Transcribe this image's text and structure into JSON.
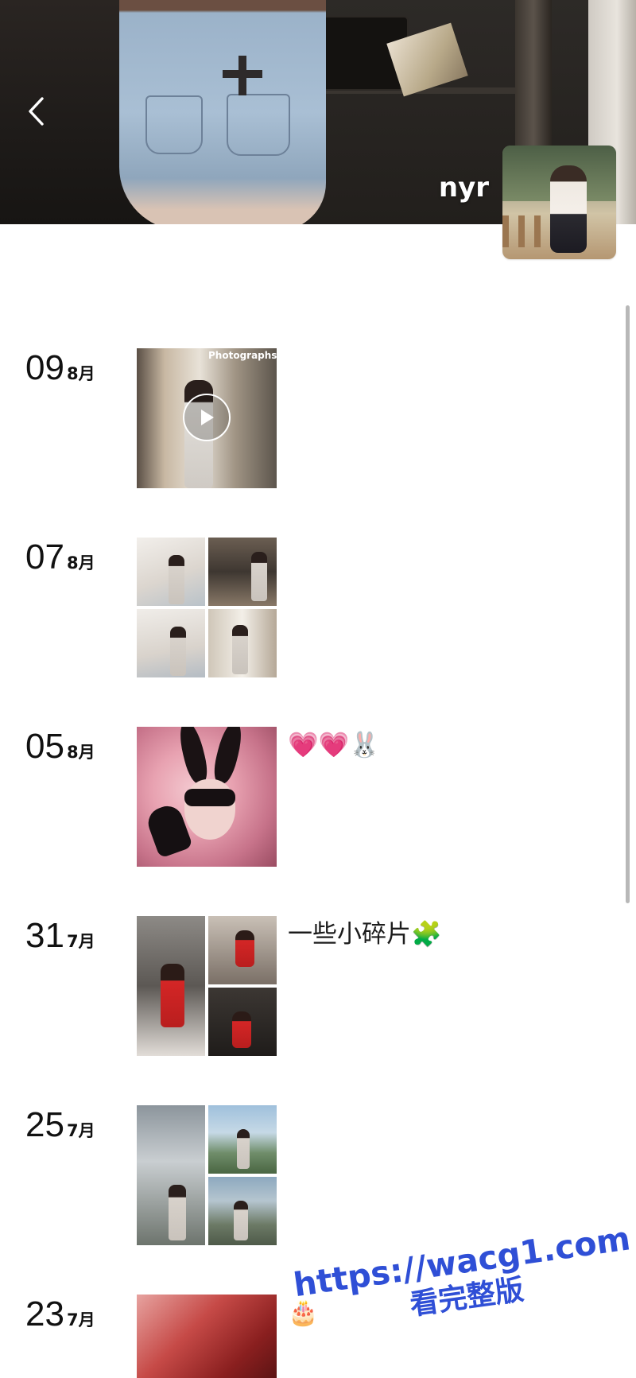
{
  "header": {
    "profile_name": "nyr"
  },
  "posts": [
    {
      "day": "09",
      "month": "8月",
      "caption": "",
      "media_type": "video"
    },
    {
      "day": "07",
      "month": "8月",
      "caption": "",
      "media_type": "grid-4"
    },
    {
      "day": "05",
      "month": "8月",
      "caption": "💗💗🐰",
      "media_type": "single"
    },
    {
      "day": "31",
      "month": "7月",
      "caption": "一些小碎片🧩",
      "media_type": "grid-3"
    },
    {
      "day": "25",
      "month": "7月",
      "caption": "",
      "media_type": "grid-4"
    },
    {
      "day": "23",
      "month": "7月",
      "caption": "🎂",
      "media_type": "single"
    }
  ],
  "media_text": {
    "first_video_overlay": "Photographs"
  },
  "watermark": {
    "url": "https://wacg1.com",
    "text": "看完整版",
    "color": "#2f4fd6"
  },
  "icons": {
    "back": "chevron-left-icon",
    "play": "play-icon"
  }
}
